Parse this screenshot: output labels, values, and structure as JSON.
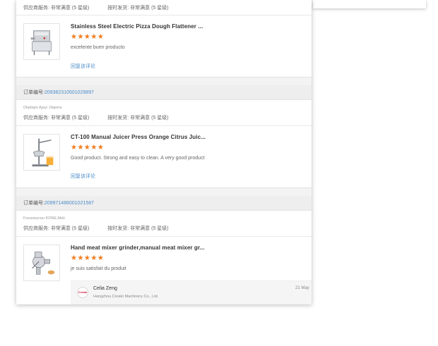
{
  "meta_labels": {
    "supplier_service": "供应商服务:",
    "on_time_shipping": "按时发货:",
    "very_satisfied": "非常满意",
    "level": "(5 星级)",
    "order_prefix": "订单编号:",
    "reply_link": "回复该评论"
  },
  "reviews": [
    {
      "title": "Stainless Steel Electric Pizza Dough Flattener ...",
      "stars": "★★★★★",
      "comment": "excelente buen producto",
      "image_icon": "dough-flattener-machine-icon"
    },
    {
      "order_number": "209382310501029897",
      "buyer": "Oladapo Ajayi ,Nigeria",
      "title": "CT-100 Manual Juicer Press Orange Citrus Juic...",
      "stars": "★★★★★",
      "comment": "Good product. Strong and easy to clean. A very good product",
      "image_icon": "juicer-press-icon"
    },
    {
      "order_number": "209971486001021587",
      "buyer": "Fousseynou KONE,Mali",
      "title": "Hand meat mixer grinder,manual meat mixer gr...",
      "stars": "★★★★★",
      "comment": "je suis satisfait du produit",
      "image_icon": "meat-grinder-icon",
      "reply": {
        "logo_text": "Creato",
        "name": "Celia Zeng",
        "company": "Hangzhou Creato Machinery Co., Ltd.",
        "date": "21 May"
      }
    }
  ],
  "colors": {
    "star": "#f27a1a",
    "link": "#4a8cc9",
    "order_bar": "#eeeeee"
  }
}
